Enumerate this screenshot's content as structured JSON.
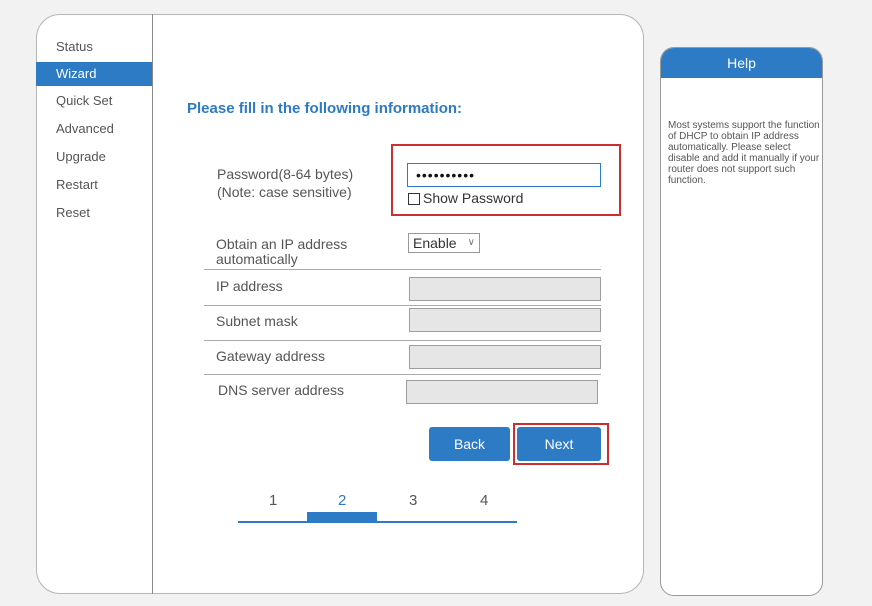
{
  "sidebar": {
    "items": [
      {
        "label": "Status"
      },
      {
        "label": "Wizard"
      },
      {
        "label": "Quick Set"
      },
      {
        "label": "Advanced"
      },
      {
        "label": "Upgrade"
      },
      {
        "label": "Restart"
      },
      {
        "label": "Reset"
      }
    ],
    "active": "Wizard"
  },
  "main": {
    "title": "Please fill in the following information:",
    "password": {
      "label_line1": "Password(8-64 bytes)",
      "label_line2": "(Note: case sensitive)",
      "value": "••••••••••",
      "show_password_label": "Show Password",
      "show_password_checked": false
    },
    "dhcp": {
      "label_line1": "Obtain an IP address",
      "label_line2": "automatically",
      "selected": "Enable"
    },
    "fields": {
      "ip_address": "IP address",
      "subnet_mask": "Subnet mask",
      "gateway_address": "Gateway address",
      "dns_server_address": "DNS server address"
    },
    "buttons": {
      "back": "Back",
      "next": "Next"
    },
    "steps": [
      "1",
      "2",
      "3",
      "4"
    ],
    "current_step": "2"
  },
  "help": {
    "title": "Help",
    "text": "Most systems support the function of DHCP to obtain IP address automatically. Please select disable and add it manually if your router does not support such function."
  },
  "colors": {
    "accent": "#2c7bc4",
    "highlight": "#cc2f2f",
    "disabled_field": "#e6e6e6"
  }
}
